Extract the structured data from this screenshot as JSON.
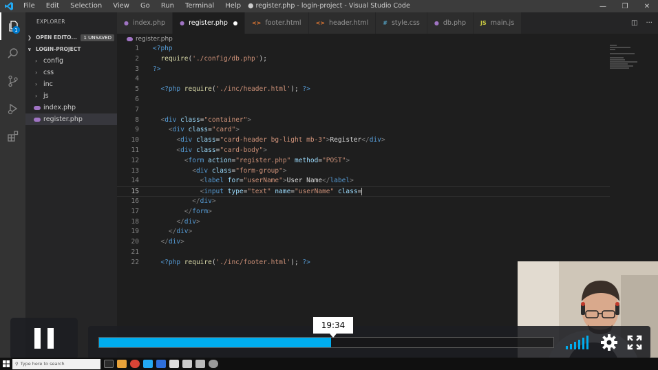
{
  "titlebar": {
    "menu": [
      "File",
      "Edit",
      "Selection",
      "View",
      "Go",
      "Run",
      "Terminal",
      "Help"
    ],
    "window_title": "● register.php - login-project - Visual Studio Code"
  },
  "activity": {
    "explorer_badge": "1"
  },
  "sidebar": {
    "title": "EXPLORER",
    "open_editors": {
      "label": "OPEN EDITO...",
      "unsaved": "1 UNSAVED"
    },
    "project": {
      "label": "LOGIN-PROJECT"
    },
    "folders": [
      "config",
      "css",
      "inc",
      "js"
    ],
    "files": [
      "index.php",
      "register.php"
    ]
  },
  "tabs": [
    {
      "label": "index.php",
      "icon": "php-icon",
      "color": "#a074c4"
    },
    {
      "label": "register.php",
      "icon": "php-icon",
      "color": "#a074c4"
    },
    {
      "label": "footer.html",
      "icon": "html-icon",
      "color": "#e37933"
    },
    {
      "label": "header.html",
      "icon": "html-icon",
      "color": "#e37933"
    },
    {
      "label": "style.css",
      "icon": "css-icon",
      "color": "#519aba"
    },
    {
      "label": "db.php",
      "icon": "php-icon",
      "color": "#a074c4"
    },
    {
      "label": "main.js",
      "icon": "js-icon",
      "color": "#cbcb41"
    }
  ],
  "breadcrumb": "register.php",
  "editor": {
    "line_numbers": [
      "1",
      "2",
      "3",
      "4",
      "5",
      "6",
      "7",
      "8",
      "9",
      "10",
      "11",
      "12",
      "13",
      "14",
      "15",
      "16",
      "17",
      "18",
      "19",
      "20",
      "21",
      "22"
    ]
  },
  "video": {
    "time_tooltip": "19:34",
    "progress_fraction": 0.51
  },
  "taskbar": {
    "search_placeholder": "Type here to search"
  }
}
